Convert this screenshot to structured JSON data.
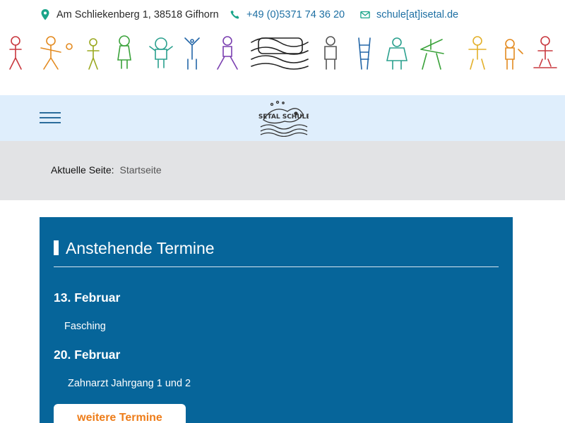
{
  "topbar": {
    "address": "Am Schliekenberg 1, 38518 Gifhorn",
    "phone": "+49 (0)5371 74 36 20",
    "email": "schule[at]isetal.de",
    "icons": {
      "address": "map-pin-icon",
      "phone": "phone-icon",
      "email": "envelope-icon"
    },
    "colors": {
      "icon": "#1aa58a",
      "link": "#1d6fa3"
    }
  },
  "header": {
    "banner": "children-drawings-banner",
    "logo_text": "ISETAL SCHULE"
  },
  "navbar": {
    "menu_icon": "hamburger-menu-icon",
    "background": "#dfeefc"
  },
  "breadcrumb": {
    "label": "Aktuelle Seite:",
    "current": "Startseite"
  },
  "events": {
    "title": "Anstehende Termine",
    "items": [
      {
        "date": "13. Februar",
        "name": "Fasching"
      },
      {
        "date": "20. Februar",
        "name": "Zahnarzt Jahrgang 1 und 2"
      }
    ],
    "more_label": "weitere Termine",
    "colors": {
      "panel": "#06659a",
      "button_text": "#ee7d1a"
    }
  }
}
